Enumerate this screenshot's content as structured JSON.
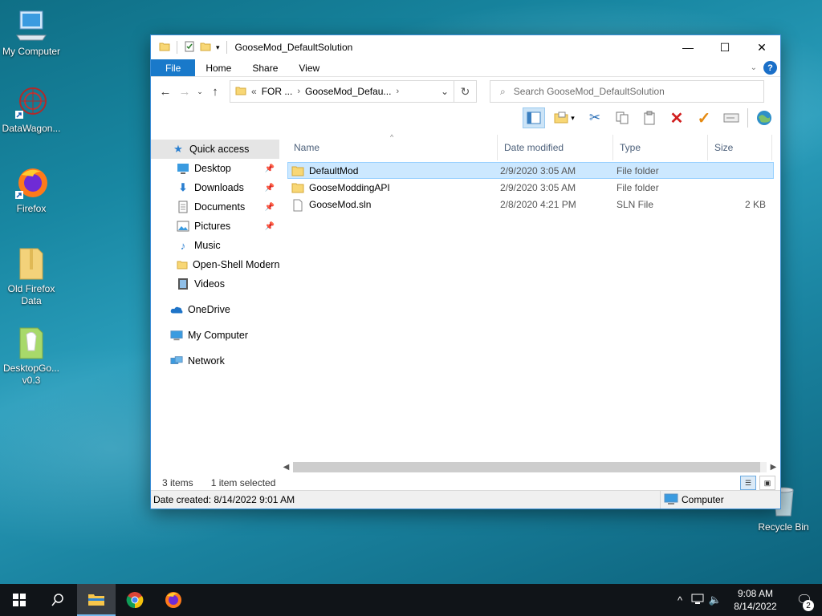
{
  "desktop": {
    "icons": [
      {
        "label": "My Computer"
      },
      {
        "label": "DataWagon..."
      },
      {
        "label": "Firefox"
      },
      {
        "label": "Old Firefox Data"
      },
      {
        "label": "DesktopGo... v0.3"
      },
      {
        "label": "Recycle Bin"
      }
    ]
  },
  "window": {
    "title": "GooseMod_DefaultSolution",
    "controls": {
      "minimize": "—",
      "maximize": "☐",
      "close": "✕"
    },
    "ribbon": {
      "tabs": [
        "File",
        "Home",
        "Share",
        "View"
      ],
      "help": "?"
    },
    "address": {
      "prefix": "«",
      "crumbs": [
        "FOR ...",
        "GooseMod_Defau..."
      ],
      "search_placeholder": "Search GooseMod_DefaultSolution"
    },
    "nav": {
      "quick_access": "Quick access",
      "items": [
        {
          "label": "Desktop",
          "icon": "desktop-icon",
          "pinned": true
        },
        {
          "label": "Downloads",
          "icon": "downloads-icon",
          "pinned": true
        },
        {
          "label": "Documents",
          "icon": "documents-icon",
          "pinned": true
        },
        {
          "label": "Pictures",
          "icon": "pictures-icon",
          "pinned": true
        },
        {
          "label": "Music",
          "icon": "music-icon",
          "pinned": false
        },
        {
          "label": "Open-Shell Modern",
          "icon": "folder-icon",
          "pinned": false
        },
        {
          "label": "Videos",
          "icon": "videos-icon",
          "pinned": false
        }
      ],
      "onedrive": "OneDrive",
      "computer": "My Computer",
      "network": "Network"
    },
    "columns": [
      "Name",
      "Date modified",
      "Type",
      "Size"
    ],
    "files": [
      {
        "name": "DefaultMod",
        "date": "2/9/2020 3:05 AM",
        "type": "File folder",
        "size": "",
        "kind": "folder",
        "selected": true
      },
      {
        "name": "GooseModdingAPI",
        "date": "2/9/2020 3:05 AM",
        "type": "File folder",
        "size": "",
        "kind": "folder",
        "selected": false
      },
      {
        "name": "GooseMod.sln",
        "date": "2/8/2020 4:21 PM",
        "type": "SLN File",
        "size": "2 KB",
        "kind": "file",
        "selected": false
      }
    ],
    "status": {
      "count": "3 items",
      "selection": "1 item selected"
    },
    "details": {
      "created": "Date created: 8/14/2022 9:01 AM",
      "location": "Computer"
    }
  },
  "taskbar": {
    "time": "9:08 AM",
    "date": "8/14/2022",
    "notifications": "2"
  },
  "colors": {
    "accent": "#1979ca",
    "selection": "#cce8ff",
    "folder": "#f8d775"
  }
}
